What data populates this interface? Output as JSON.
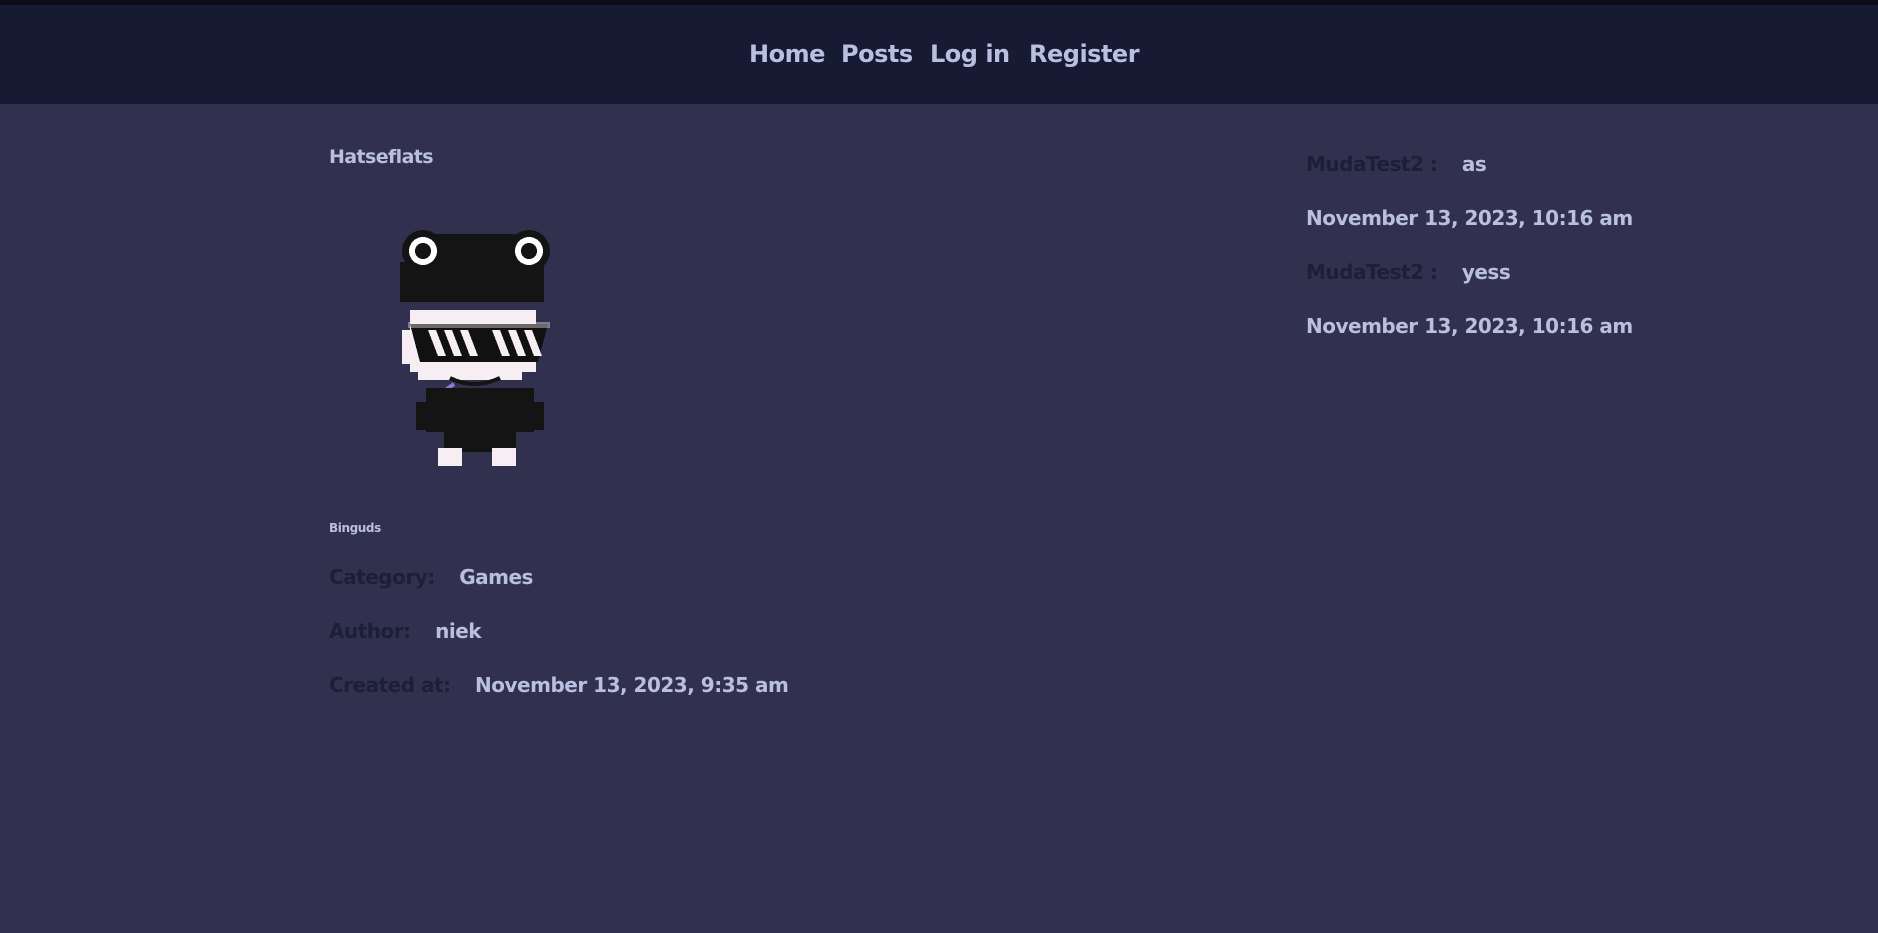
{
  "nav": {
    "items": [
      {
        "label": "Home"
      },
      {
        "label": "Posts"
      },
      {
        "label": "Log in"
      },
      {
        "label": "Register"
      }
    ]
  },
  "post": {
    "title": "Hatseflats",
    "image_icon": "frog-hat-character-avatar",
    "body": "Binguds",
    "category_label": "Category:",
    "category": "Games",
    "author_label": "Author:",
    "author": "niek",
    "created_label": "Created at:",
    "created_at": "November 13, 2023, 9:35 am"
  },
  "comments": [
    {
      "author": "MudaTest2 :",
      "text": "as",
      "date": "November 13, 2023, 10:16 am"
    },
    {
      "author": "MudaTest2 :",
      "text": "yess",
      "date": "November 13, 2023, 10:16 am"
    }
  ],
  "colors": {
    "page_background": "#32304f",
    "navbar_background": "#161a33",
    "text_light": "#b9bfe0",
    "text_dark": "#1c1f38"
  }
}
